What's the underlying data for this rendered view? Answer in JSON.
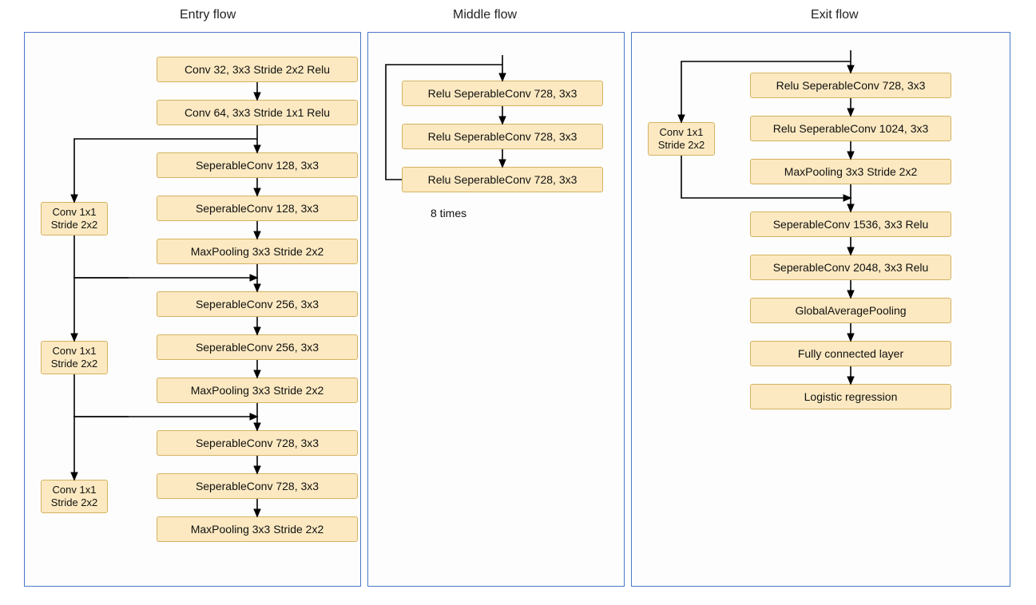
{
  "titles": {
    "entry": "Entry flow",
    "middle": "Middle flow",
    "exit": "Exit flow"
  },
  "entry": {
    "main": [
      "Conv 32, 3x3 Stride 2x2 Relu",
      "Conv 64, 3x3 Stride 1x1 Relu",
      "SeperableConv 128, 3x3",
      "SeperableConv 128, 3x3",
      "MaxPooling 3x3 Stride 2x2",
      "SeperableConv 256, 3x3",
      "SeperableConv 256, 3x3",
      "MaxPooling 3x3 Stride 2x2",
      "SeperableConv 728, 3x3",
      "SeperableConv 728, 3x3",
      "MaxPooling 3x3 Stride 2x2"
    ],
    "side": [
      "Conv 1x1\nStride 2x2",
      "Conv 1x1\nStride 2x2",
      "Conv 1x1\nStride 2x2"
    ]
  },
  "middle": {
    "main": [
      "Relu SeperableConv 728, 3x3",
      "Relu SeperableConv 728, 3x3",
      "Relu SeperableConv 728, 3x3"
    ],
    "note": "8 times"
  },
  "exit": {
    "main": [
      "Relu SeperableConv 728, 3x3",
      "Relu SeperableConv 1024, 3x3",
      "MaxPooling 3x3 Stride 2x2",
      "SeperableConv 1536, 3x3 Relu",
      "SeperableConv 2048, 3x3 Relu",
      "GlobalAveragePooling",
      "Fully connected layer",
      "Logistic regression"
    ],
    "side": [
      "Conv 1x1\nStride 2x2"
    ]
  }
}
